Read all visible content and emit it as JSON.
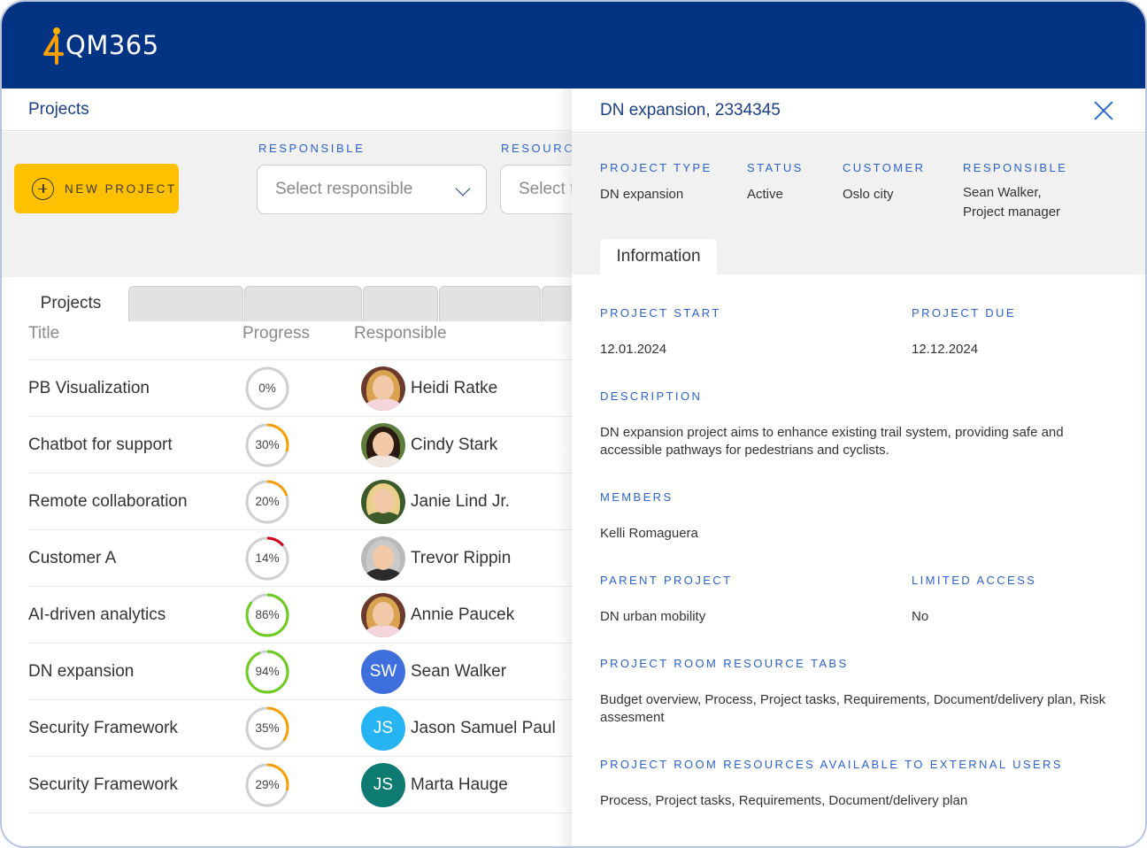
{
  "app": {
    "logo_text": "QM365",
    "brand_color": "#033483",
    "accent_color": "#ffc000"
  },
  "left": {
    "page_title": "Projects",
    "new_project_label": "NEW PROJECT",
    "filters": [
      {
        "label": "RESPONSIBLE",
        "placeholder": "Select responsible"
      },
      {
        "label": "RESOURCE",
        "placeholder": "Select t"
      }
    ],
    "tabs": [
      {
        "label": "Projects",
        "active": true
      },
      {
        "label": ""
      },
      {
        "label": ""
      },
      {
        "label": ""
      },
      {
        "label": ""
      },
      {
        "label": ""
      }
    ],
    "table": {
      "columns": [
        "Title",
        "Progress",
        "Responsible"
      ],
      "rows": [
        {
          "title": "PB Visualization",
          "progress": 0,
          "progress_label": "0%",
          "responsible": "Heidi Ratke",
          "avatar": "photo",
          "avatar_hair": "#d8a24e",
          "avatar_body": "#f4d6dc",
          "avatar_bg": "#6b3a2e"
        },
        {
          "title": "Chatbot for support",
          "progress": 30,
          "progress_label": "30%",
          "responsible": "Cindy Stark",
          "avatar": "photo",
          "avatar_hair": "#2a1a12",
          "avatar_body": "#efe7e0",
          "avatar_bg": "#5f7d3a"
        },
        {
          "title": "Remote collaboration",
          "progress": 20,
          "progress_label": "20%",
          "responsible": "Janie Lind Jr.",
          "avatar": "photo",
          "avatar_hair": "#e9cf8a",
          "avatar_body": "#3d5a2a",
          "avatar_bg": "#3d5a2a"
        },
        {
          "title": "Customer A",
          "progress": 14,
          "progress_label": "14%",
          "responsible": "Trevor Rippin",
          "avatar": "photo",
          "avatar_hair": "#c9c9c9",
          "avatar_body": "#2b2b2b",
          "avatar_bg": "#b9b9b9"
        },
        {
          "title": "AI-driven analytics",
          "progress": 86,
          "progress_label": "86%",
          "responsible": "Annie Paucek",
          "avatar": "photo",
          "avatar_hair": "#d8a24e",
          "avatar_body": "#f4d6dc",
          "avatar_bg": "#6b3a2e"
        },
        {
          "title": "DN expansion",
          "progress": 94,
          "progress_label": "94%",
          "responsible": "Sean Walker",
          "avatar": "initials",
          "initials": "SW",
          "avatar_bg": "#3f6fdc"
        },
        {
          "title": "Security Framework",
          "progress": 35,
          "progress_label": "35%",
          "responsible": "Jason Samuel Paul",
          "avatar": "initials",
          "initials": "JS",
          "avatar_bg": "#27b4f5"
        },
        {
          "title": "Security Framework",
          "progress": 29,
          "progress_label": "29%",
          "responsible": "Marta Hauge",
          "avatar": "initials",
          "initials": "JS",
          "avatar_bg": "#0e7b72"
        }
      ]
    },
    "progress_colors": {
      "low": "#d0021b",
      "mid": "#f5a00a",
      "high": "#6ccc1f",
      "track": "#cfcfcf"
    }
  },
  "panel": {
    "title": "DN expansion, 2334345",
    "summary": {
      "project_type": {
        "label": "PROJECT TYPE",
        "value": "DN expansion"
      },
      "status": {
        "label": "STATUS",
        "value": "Active"
      },
      "customer": {
        "label": "CUSTOMER",
        "value": "Oslo city"
      },
      "responsible": {
        "label": "RESPONSIBLE",
        "value_line1": "Sean Walker,",
        "value_line2": "Project manager"
      }
    },
    "tab_label": "Information",
    "info": {
      "project_start": {
        "label": "PROJECT START",
        "value": "12.01.2024"
      },
      "project_due": {
        "label": "PROJECT DUE",
        "value": "12.12.2024"
      },
      "description": {
        "label": "DESCRIPTION",
        "value": "DN expansion project aims to enhance existing trail system, providing safe and accessible pathways for pedestrians and cyclists."
      },
      "members": {
        "label": "MEMBERS",
        "value": "Kelli Romaguera"
      },
      "parent_project": {
        "label": "PARENT PROJECT",
        "value": "DN urban mobility"
      },
      "limited_access": {
        "label": "LIMITED ACCESS",
        "value": "No"
      },
      "resource_tabs": {
        "label": "PROJECT ROOM RESOURCE TABS",
        "value": "Budget overview, Process, Project tasks, Requirements, Document/delivery plan, Risk assesment"
      },
      "external_resources": {
        "label": "PROJECT ROOM RESOURCES AVAILABLE TO EXTERNAL USERS",
        "value": "Process, Project tasks, Requirements, Document/delivery plan"
      }
    }
  }
}
